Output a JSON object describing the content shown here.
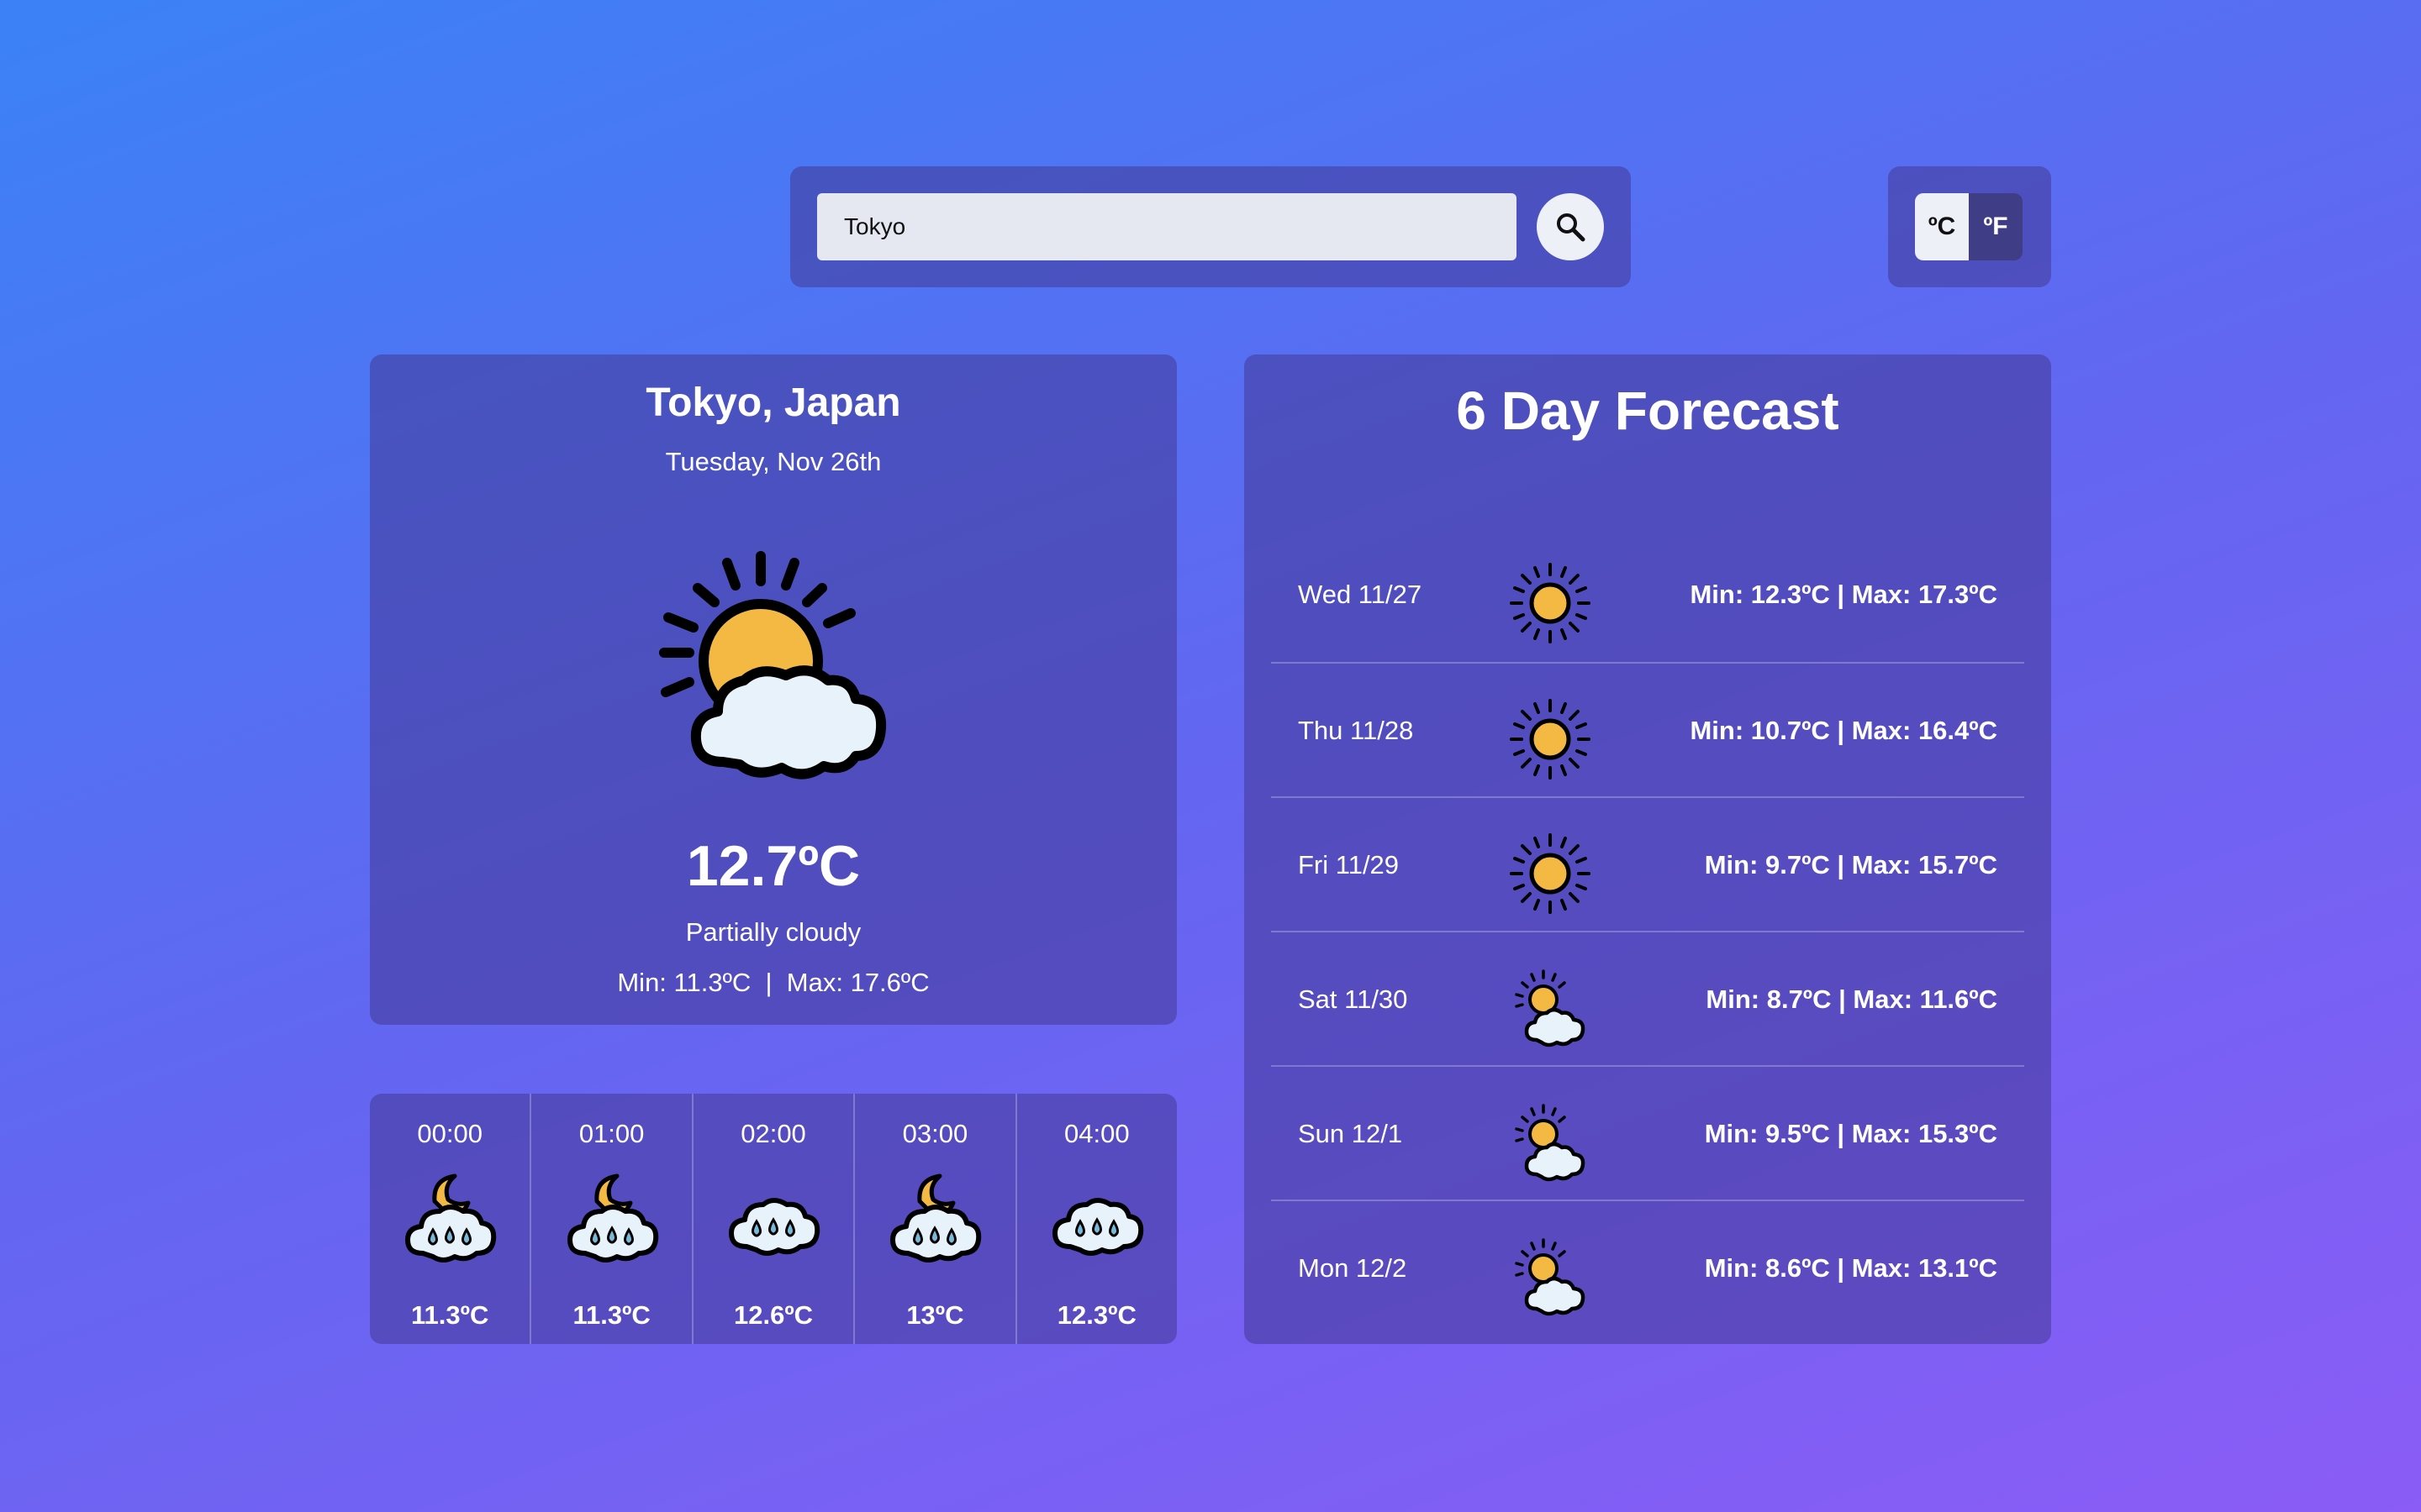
{
  "search": {
    "value": "Tokyo",
    "button_icon": "search-icon"
  },
  "units": {
    "celsius_label": "ºC",
    "fahrenheit_label": "ºF",
    "selected": "celsius"
  },
  "current": {
    "city": "Tokyo, Japan",
    "date": "Tuesday, Nov 26th",
    "icon": "partly-cloudy-icon",
    "temp": "12.7ºC",
    "condition": "Partially cloudy",
    "minmax": "Min: 11.3ºC  |  Max: 17.6ºC"
  },
  "hourly": [
    {
      "time": "00:00",
      "icon": "night-rain-icon",
      "temp": "11.3ºC"
    },
    {
      "time": "01:00",
      "icon": "night-rain-icon",
      "temp": "11.3ºC"
    },
    {
      "time": "02:00",
      "icon": "rain-cloud-icon",
      "temp": "12.6ºC"
    },
    {
      "time": "03:00",
      "icon": "night-rain-icon",
      "temp": "13ºC"
    },
    {
      "time": "04:00",
      "icon": "rain-cloud-icon",
      "temp": "12.3ºC"
    }
  ],
  "forecast": {
    "title": "6 Day Forecast",
    "days": [
      {
        "day": "Wed 11/27",
        "icon": "sun-icon",
        "minmax": "Min: 12.3ºC | Max: 17.3ºC"
      },
      {
        "day": "Thu 11/28",
        "icon": "sun-icon",
        "minmax": "Min: 10.7ºC | Max: 16.4ºC"
      },
      {
        "day": "Fri 11/29",
        "icon": "sun-icon",
        "minmax": "Min: 9.7ºC | Max: 15.7ºC"
      },
      {
        "day": "Sat 11/30",
        "icon": "partly-cloudy-icon",
        "minmax": "Min: 8.7ºC | Max: 11.6ºC"
      },
      {
        "day": "Sun 12/1",
        "icon": "partly-cloudy-icon",
        "minmax": "Min: 9.5ºC | Max: 15.3ºC"
      },
      {
        "day": "Mon 12/2",
        "icon": "partly-cloudy-icon",
        "minmax": "Min: 8.6ºC | Max: 13.1ºC"
      }
    ]
  },
  "colors": {
    "sun": "#f4b942",
    "cloud": "#e8f2fa",
    "outline": "#000000",
    "panel": "#4a4fa8"
  }
}
